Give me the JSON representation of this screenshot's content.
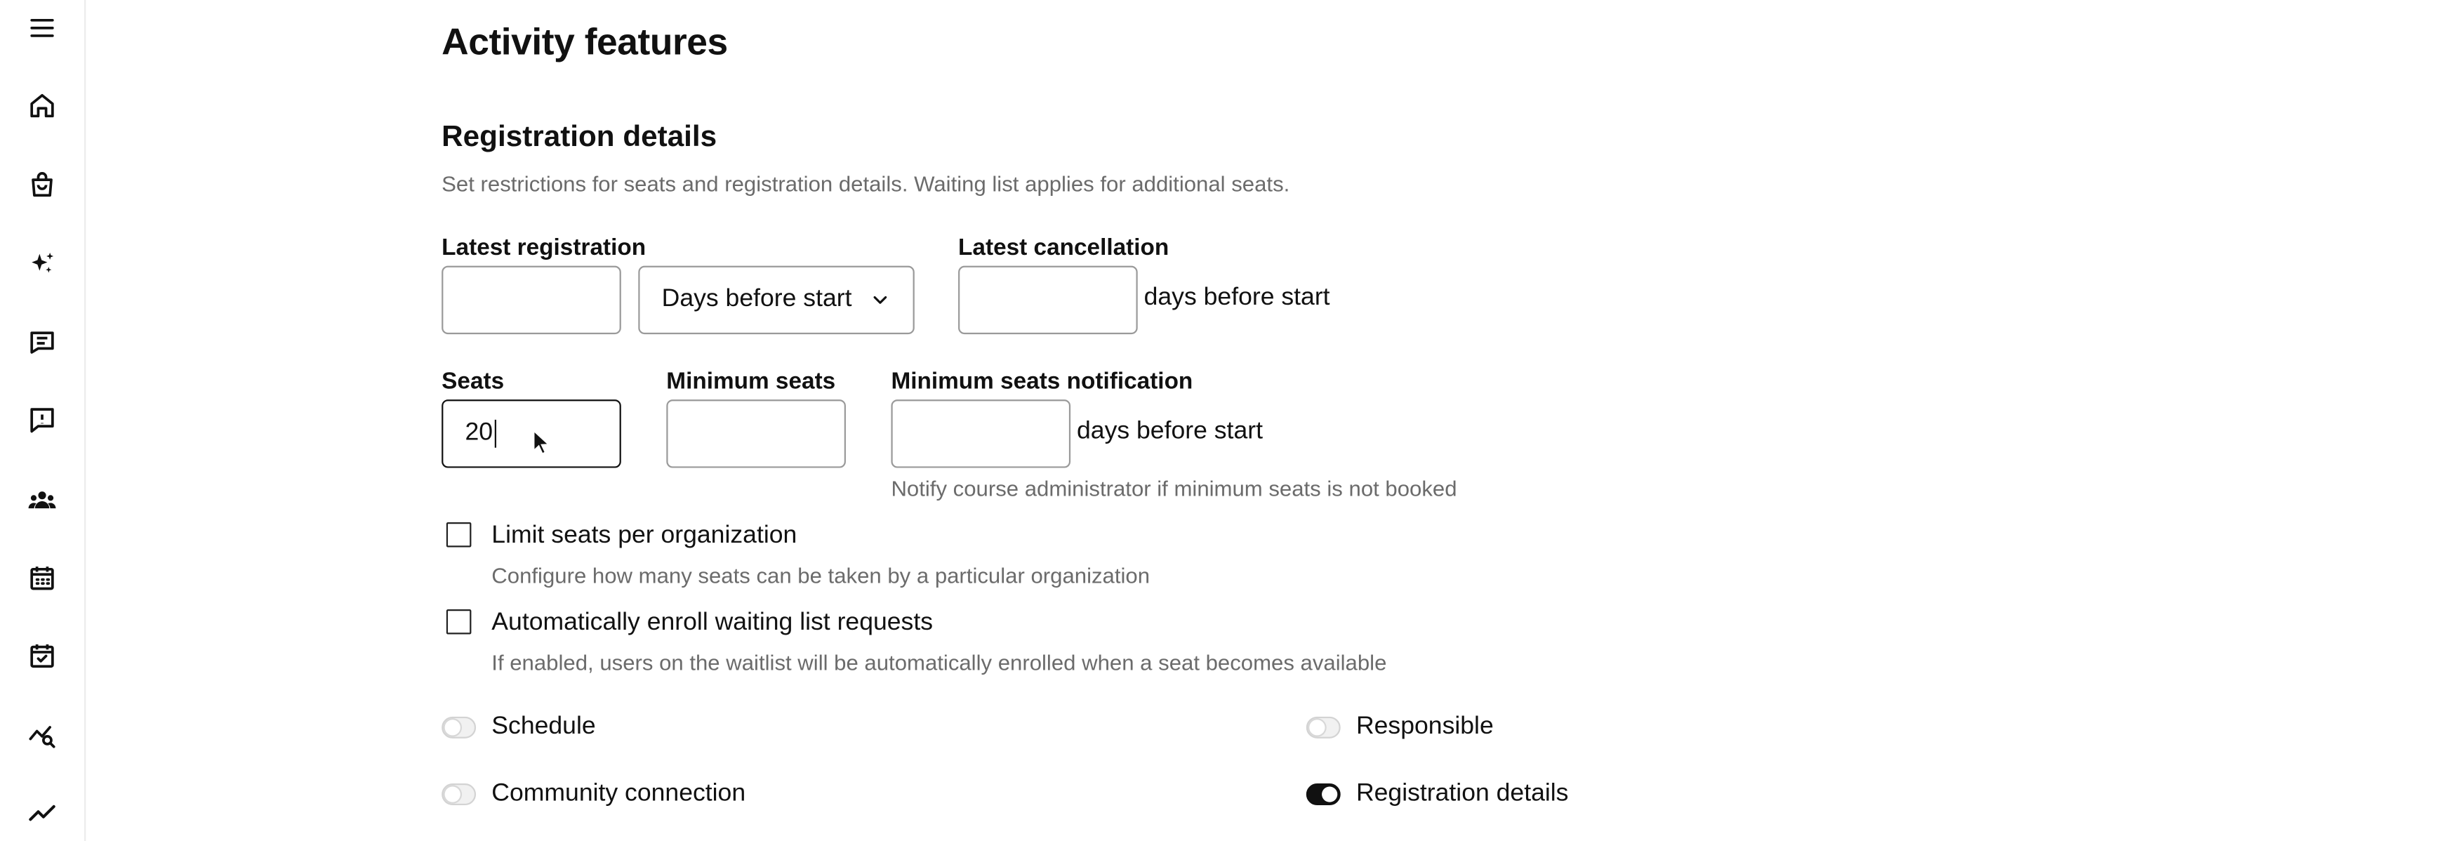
{
  "sidebar": {
    "items": [
      {
        "icon": "menu-icon"
      },
      {
        "icon": "home-icon"
      },
      {
        "icon": "shopping-bag-icon"
      },
      {
        "icon": "sparkles-icon"
      },
      {
        "icon": "message-list-icon"
      },
      {
        "icon": "message-alert-icon"
      },
      {
        "icon": "users-icon"
      },
      {
        "icon": "calendar-icon"
      },
      {
        "icon": "calendar-check-icon"
      },
      {
        "icon": "chart-search-icon"
      },
      {
        "icon": "trend-line-icon"
      }
    ]
  },
  "page": {
    "title": "Activity features"
  },
  "registration": {
    "title": "Registration details",
    "description": "Set restrictions for seats and registration details. Waiting list applies for additional seats.",
    "latest_registration": {
      "label": "Latest registration",
      "value": "",
      "unit_select": "Days before start"
    },
    "latest_cancellation": {
      "label": "Latest cancellation",
      "value": "",
      "suffix": "days before start"
    },
    "seats": {
      "label": "Seats",
      "value": "20"
    },
    "minimum_seats": {
      "label": "Minimum seats",
      "value": ""
    },
    "minimum_seats_notification": {
      "label": "Minimum seats notification",
      "value": "",
      "suffix": "days before start",
      "hint": "Notify course administrator if minimum seats is not booked"
    },
    "limit_seats": {
      "label": "Limit seats per organization",
      "hint": "Configure how many seats can be taken by a particular organization",
      "checked": false
    },
    "auto_enroll": {
      "label": "Automatically enroll waiting list requests",
      "hint": "If enabled, users on the waitlist will be automatically enrolled when a seat becomes available",
      "checked": false
    }
  },
  "features": {
    "left": [
      {
        "label": "Schedule",
        "enabled": false
      },
      {
        "label": "Community connection",
        "enabled": false
      }
    ],
    "right": [
      {
        "label": "Responsible",
        "enabled": false
      },
      {
        "label": "Registration details",
        "enabled": true
      }
    ]
  },
  "colors": {
    "toggle_on": "#111111",
    "hint_text": "#6b6b6b",
    "border": "#9a9a9a"
  }
}
